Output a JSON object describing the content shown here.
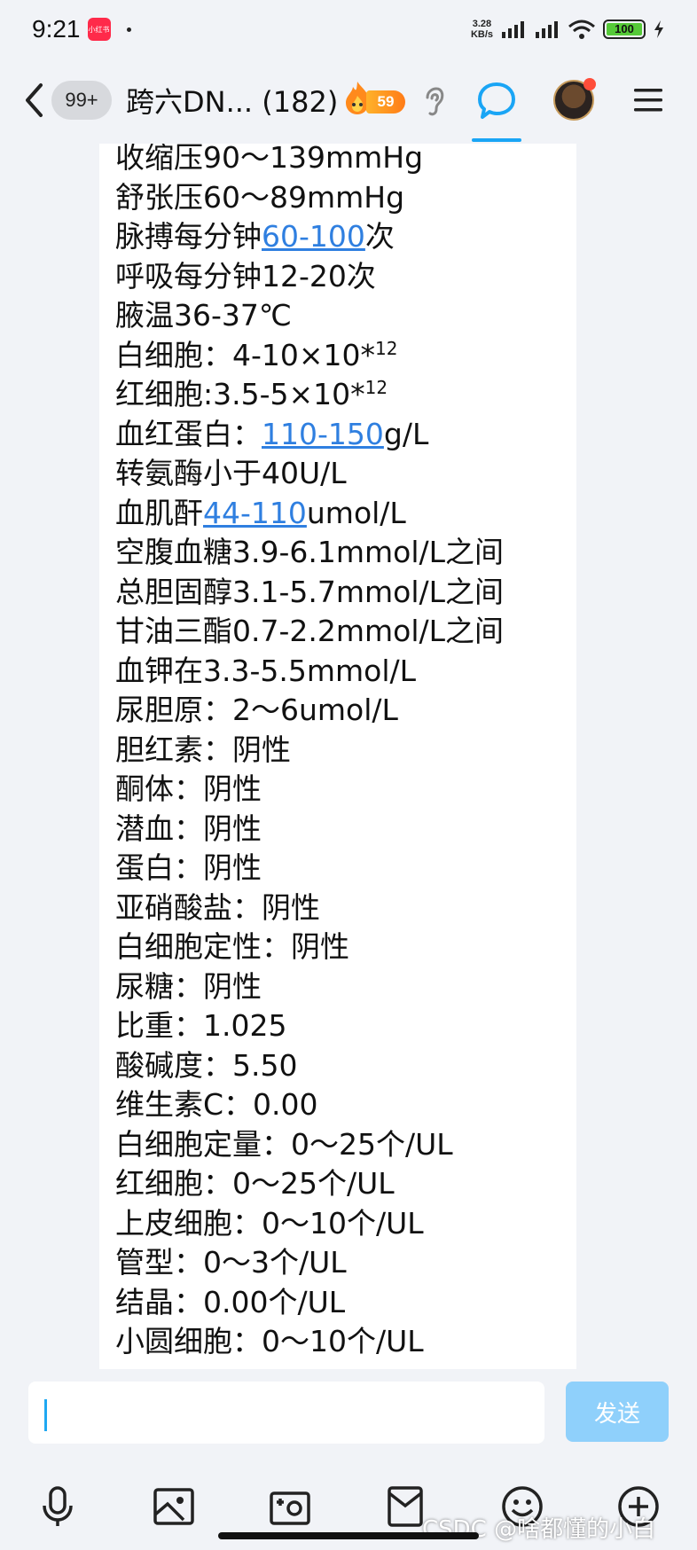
{
  "status_bar": {
    "time": "9:21",
    "app_badge": "小红书",
    "net_speed_value": "3.28",
    "net_speed_unit": "KB/s",
    "battery": "100"
  },
  "header": {
    "unread_count": "99+",
    "title": "跨六DN... (182)",
    "level": "59",
    "icons": [
      "back-icon",
      "fire-icon",
      "ear-icon",
      "chat-icon",
      "avatar",
      "menu-icon"
    ]
  },
  "message": {
    "lines": [
      [
        {
          "text": "收缩压90～139mmHg"
        }
      ],
      [
        {
          "text": "舒张压60～89mmHg"
        }
      ],
      [
        {
          "text": "脉搏每分钟"
        },
        {
          "text": "60-100",
          "link": true
        },
        {
          "text": "次"
        }
      ],
      [
        {
          "text": "呼吸每分钟12-20次"
        }
      ],
      [
        {
          "text": "腋温36-37℃"
        }
      ],
      [
        {
          "text": "白细胞：4-10×10*"
        },
        {
          "text": "12",
          "sup": true
        }
      ],
      [
        {
          "text": "红细胞:3.5-5×10*"
        },
        {
          "text": "12",
          "sup": true
        }
      ],
      [
        {
          "text": "血红蛋白："
        },
        {
          "text": "110-150",
          "link": true
        },
        {
          "text": "g/L"
        }
      ],
      [
        {
          "text": "转氨酶小于40U/L"
        }
      ],
      [
        {
          "text": "血肌酐"
        },
        {
          "text": "44-110",
          "link": true
        },
        {
          "text": "umol/L"
        }
      ],
      [
        {
          "text": "空腹血糖3.9-6.1mmol/L之间"
        }
      ],
      [
        {
          "text": "总胆固醇3.1-5.7mmol/L之间"
        }
      ],
      [
        {
          "text": "甘油三酯0.7-2.2mmol/L之间"
        }
      ],
      [
        {
          "text": "血钾在3.3-5.5mmol/L"
        }
      ],
      [
        {
          "text": "尿胆原：2～6umol/L"
        }
      ],
      [
        {
          "text": "胆红素：阴性"
        }
      ],
      [
        {
          "text": "酮体：阴性"
        }
      ],
      [
        {
          "text": "潜血：阴性"
        }
      ],
      [
        {
          "text": "蛋白：阴性"
        }
      ],
      [
        {
          "text": "亚硝酸盐：阴性"
        }
      ],
      [
        {
          "text": "白细胞定性：阴性"
        }
      ],
      [
        {
          "text": "尿糖：阴性"
        }
      ],
      [
        {
          "text": "比重：1.025"
        }
      ],
      [
        {
          "text": "酸碱度：5.50"
        }
      ],
      [
        {
          "text": "维生素C：0.00"
        }
      ],
      [
        {
          "text": "白细胞定量：0～25个/UL"
        }
      ],
      [
        {
          "text": "红细胞：0～25个/UL"
        }
      ],
      [
        {
          "text": "上皮细胞：0～10个/UL"
        }
      ],
      [
        {
          "text": "管型：0～3个/UL"
        }
      ],
      [
        {
          "text": "结晶：0.00个/UL"
        }
      ],
      [
        {
          "text": "小圆细胞：0～10个/UL"
        }
      ]
    ]
  },
  "input": {
    "value": "",
    "send_label": "发送"
  },
  "toolbar": {
    "items": [
      "microphone-icon",
      "image-icon",
      "camera-icon",
      "red-packet-icon",
      "emoji-icon",
      "plus-icon"
    ]
  },
  "watermark": "CSDC @啥都懂的小白",
  "colors": {
    "link": "#2f7fe0",
    "accent": "#1aa5f5",
    "send_button": "#8fd0fb",
    "background": "#f1f3f7"
  }
}
